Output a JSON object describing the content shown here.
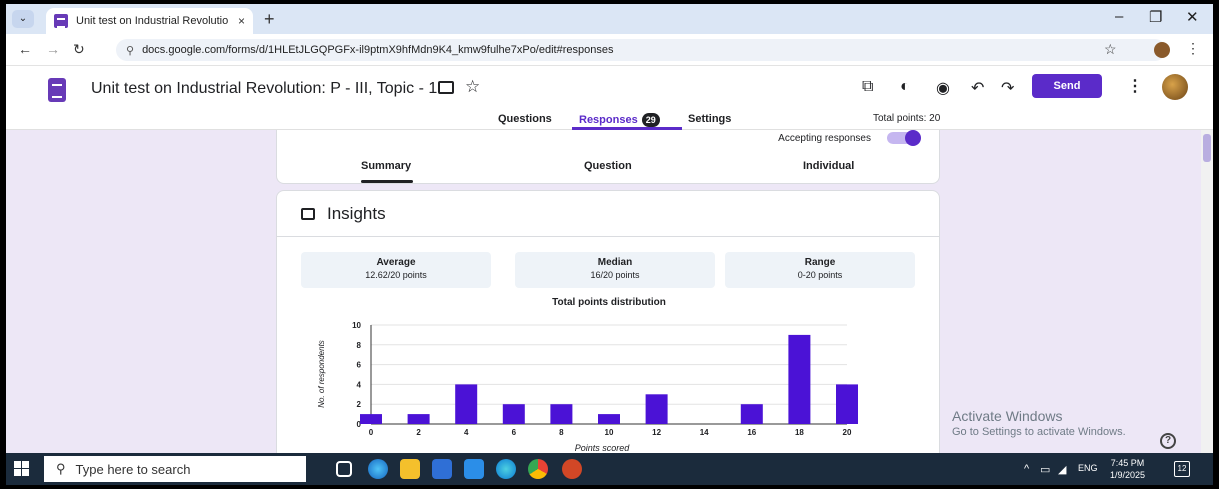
{
  "browser": {
    "tab_title": "Unit test on Industrial Revolutio",
    "tab_close": "×",
    "new_tab": "+",
    "url_host": "docs.google.com",
    "url_path": "/forms/d/1HLEtJLGQPGFx-il9ptmX9hfMdn9K4_kmw9fulhe7xPo/edit#responses",
    "minimize": "–",
    "restore": "❐",
    "close": "✕"
  },
  "form": {
    "title": "Unit test on Industrial Revolution: P - III, Topic - 1",
    "send_label": "Send",
    "tabs": [
      {
        "label": "Questions"
      },
      {
        "label": "Responses"
      },
      {
        "label": "Settings"
      }
    ],
    "responses_count": "29",
    "total_points": "Total points: 20",
    "accepting_label": "Accepting responses",
    "accepting_on": true
  },
  "subtabs": [
    "Summary",
    "Question",
    "Individual"
  ],
  "insights": {
    "title": "Insights",
    "stats": [
      {
        "label": "Average",
        "value": "12.62/20 points"
      },
      {
        "label": "Median",
        "value": "16/20 points"
      },
      {
        "label": "Range",
        "value": "0-20 points"
      }
    ]
  },
  "chart_data": {
    "type": "bar",
    "title": "Total points distribution",
    "xlabel": "Points scored",
    "ylabel": "No. of respondents",
    "x_ticks": [
      "0",
      "2",
      "4",
      "6",
      "8",
      "10",
      "12",
      "14",
      "16",
      "18",
      "20"
    ],
    "y_ticks": [
      "0",
      "2",
      "4",
      "6",
      "8",
      "10"
    ],
    "ylim": [
      0,
      10
    ],
    "x": [
      0,
      2,
      4,
      6,
      8,
      10,
      12,
      16,
      18,
      20
    ],
    "values": [
      1,
      1,
      4,
      2,
      2,
      1,
      3,
      2,
      9,
      4
    ],
    "bar_color": "#4b12d6",
    "grid": true
  },
  "windows_notice": {
    "title": "Activate Windows",
    "subtitle": "Go to Settings to activate Windows."
  },
  "help_icon": "?",
  "taskbar": {
    "search_placeholder": "Type here to search",
    "language": "ENG",
    "time": "7:45 PM",
    "date": "1/9/2025",
    "notification_count": "12"
  },
  "colors": {
    "accent": "#5b2bc9",
    "page_bg": "#ede7f6"
  }
}
